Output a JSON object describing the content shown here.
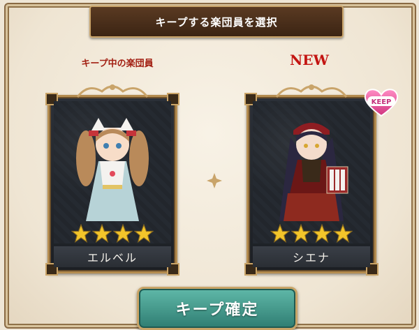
{
  "dialog": {
    "title": "キープする楽団員を選択"
  },
  "current": {
    "label": "キープ中の楽団員",
    "name": "エルベル",
    "stars": 4
  },
  "new": {
    "label": "NEW",
    "name": "シエナ",
    "stars": 4,
    "badge": "KEEP"
  },
  "confirm_button": {
    "label": "キープ確定"
  },
  "colors": {
    "frame_gold": "#b48c4f",
    "star": "#f3c52a",
    "button": "#3f988a",
    "keep_badge": "#e04a9a",
    "label_red": "#c31512"
  },
  "icons": [
    "star-icon",
    "diamond-divider-icon",
    "keep-heart-icon"
  ]
}
